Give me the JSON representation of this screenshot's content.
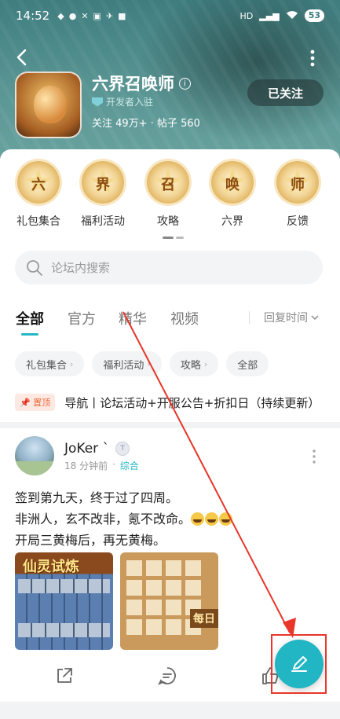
{
  "status_bar": {
    "time": "14:52",
    "battery": "53",
    "icons": [
      "notification-icon",
      "app-icon",
      "fan-icon",
      "image-icon",
      "plane-icon",
      "app-icon-2",
      "hd-icon",
      "signal-icon",
      "wifi-icon"
    ]
  },
  "header": {
    "forum_name": "六界召唤师",
    "info_symbol": "i",
    "developer_badge": "开发者入驻",
    "stats": "关注 49万+ · 帖子 560",
    "follow_label": "已关注"
  },
  "shortcuts": [
    {
      "glyph": "六",
      "label": "礼包集合"
    },
    {
      "glyph": "界",
      "label": "福利活动"
    },
    {
      "glyph": "召",
      "label": "攻略"
    },
    {
      "glyph": "唤",
      "label": "六界"
    },
    {
      "glyph": "师",
      "label": "反馈"
    }
  ],
  "search": {
    "placeholder": "论坛内搜索"
  },
  "tabs": [
    {
      "label": "全部",
      "active": true
    },
    {
      "label": "官方",
      "active": false
    },
    {
      "label": "精华",
      "active": false
    },
    {
      "label": "视频",
      "active": false
    }
  ],
  "sort": {
    "label": "回复时间"
  },
  "filters": [
    "礼包集合",
    "福利活动",
    "攻略",
    "全部"
  ],
  "pinned": {
    "badge": "置顶",
    "text": "导航丨论坛活动+开服公告+折扣日（持续更新）"
  },
  "post": {
    "author": "JoKer `",
    "level": "T",
    "time": "18 分钟前",
    "category": "综合",
    "lines": [
      "签到第九天，终于过了四周。",
      "非洲人，玄不改非，氪不改命。",
      "开局三黄梅后，再无黄梅。"
    ],
    "image1_title": "仙灵试炼",
    "image2_tag": "每日"
  },
  "colors": {
    "accent": "#22b5c3",
    "header_bg": "#4f8c8b",
    "highlight": "#e8362a",
    "pin": "#f06a3e"
  }
}
